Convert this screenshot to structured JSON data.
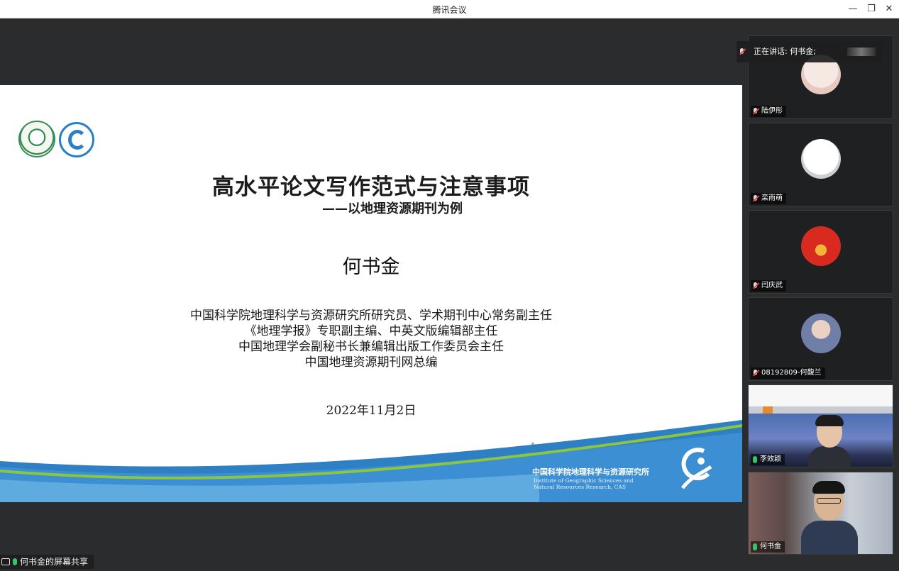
{
  "window": {
    "title": "腾讯会议",
    "minimize_icon": "—",
    "restore_icon": "❐",
    "close_icon": "✕"
  },
  "slide": {
    "title": "高水平论文写作范式与注意事项",
    "subtitle": "——以地理资源期刊为例",
    "author": "何书金",
    "affiliations": [
      "中国科学院地理科学与资源研究所研究员、学术期刊中心常务副主任",
      "《地理学报》专职副主编、中英文版编辑部主任",
      "中国地理学会副秘书长兼编辑出版工作委员会主任",
      "中国地理资源期刊网总编"
    ],
    "date": "2022年11月2日",
    "institute_cn": "中国科学院地理科学与资源研究所",
    "institute_en_1": "Institute of Geographic Sciences and",
    "institute_en_2": "Natural Resources Research, CAS"
  },
  "share_label": "何书金的屏幕共享",
  "speaking": {
    "text": "正在讲话: 何书金;"
  },
  "participants": [
    {
      "name": "陆伊彤",
      "mic": "muted"
    },
    {
      "name": "栾雨萌",
      "mic": "muted"
    },
    {
      "name": "闫庆武",
      "mic": "muted"
    },
    {
      "name": "08192809-何馥兰",
      "mic": "muted"
    },
    {
      "name": "李效颖",
      "mic": "on"
    },
    {
      "name": "何书金",
      "mic": "on"
    }
  ],
  "colors": {
    "accent_green": "#35c46a",
    "muted_red": "#e54545",
    "wave_blue": "#2f7fc4",
    "wave_green": "#8cc63f"
  }
}
